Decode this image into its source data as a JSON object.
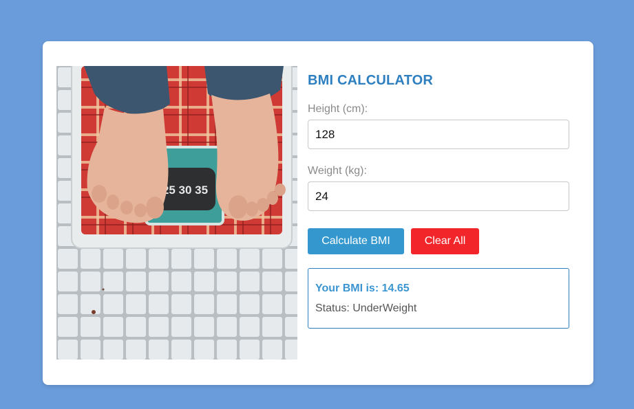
{
  "calculator": {
    "title": "BMI CALCULATOR",
    "height_label": "Height (cm):",
    "height_value": "128",
    "weight_label": "Weight (kg):",
    "weight_value": "24",
    "calculate_label": "Calculate BMI",
    "clear_label": "Clear All"
  },
  "result": {
    "bmi_text": "Your BMI is: 14.65",
    "status_text": "Status: UnderWeight"
  },
  "photo": {
    "description_icon": "scale-photo",
    "scale_dial_text": "25 30 35"
  },
  "colors": {
    "background": "#6a9bda",
    "title": "#2e7fbf",
    "calculate_button": "#3498cf",
    "clear_button": "#f1252a",
    "result_border": "#2e7fbf"
  }
}
